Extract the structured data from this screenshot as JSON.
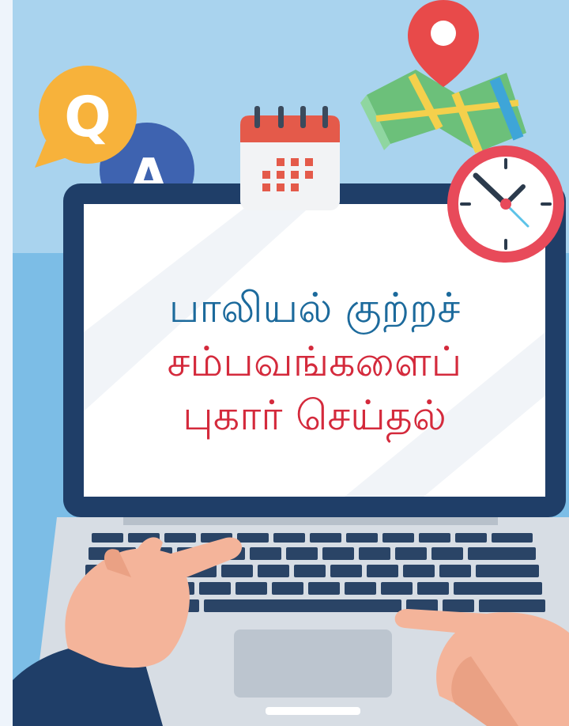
{
  "headline": {
    "line1": "பாலியல் குற்றச்",
    "line2": "சம்பவங்களைப்",
    "line3": "புகார் செய்தல்"
  },
  "colors": {
    "line1": "#1c6a9c",
    "line2": "#d42a3c",
    "line3": "#d42a3c"
  },
  "icons": {
    "qa": "q-and-a-speech-bubbles-icon",
    "calendar": "calendar-icon",
    "map": "map-pin-icon",
    "clock": "clock-icon",
    "laptop": "laptop",
    "hands": "typing-hands"
  },
  "badges": {
    "q": "Q",
    "a": "A"
  }
}
